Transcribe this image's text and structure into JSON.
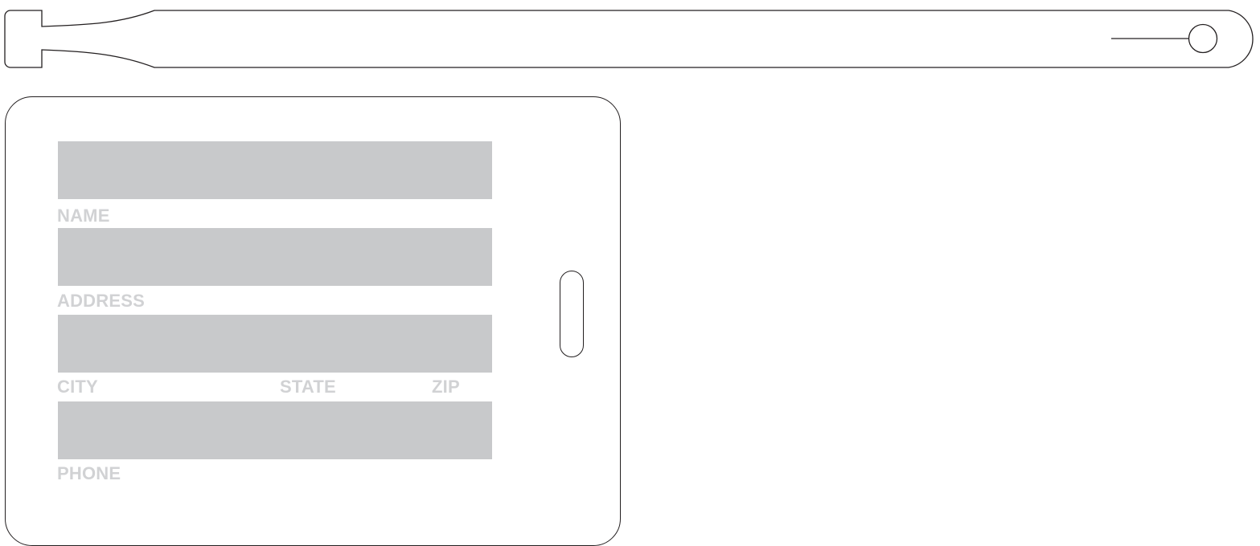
{
  "tag": {
    "fields": {
      "name_label": "NAME",
      "address_label": "ADDRESS",
      "city_label": "CITY",
      "state_label": "STATE",
      "zip_label": "ZIP",
      "phone_label": "PHONE"
    }
  },
  "colors": {
    "outline": "#231f20",
    "field_fill": "#c8c9cb",
    "label_text": "#d1d2d4",
    "background": "#ffffff"
  }
}
